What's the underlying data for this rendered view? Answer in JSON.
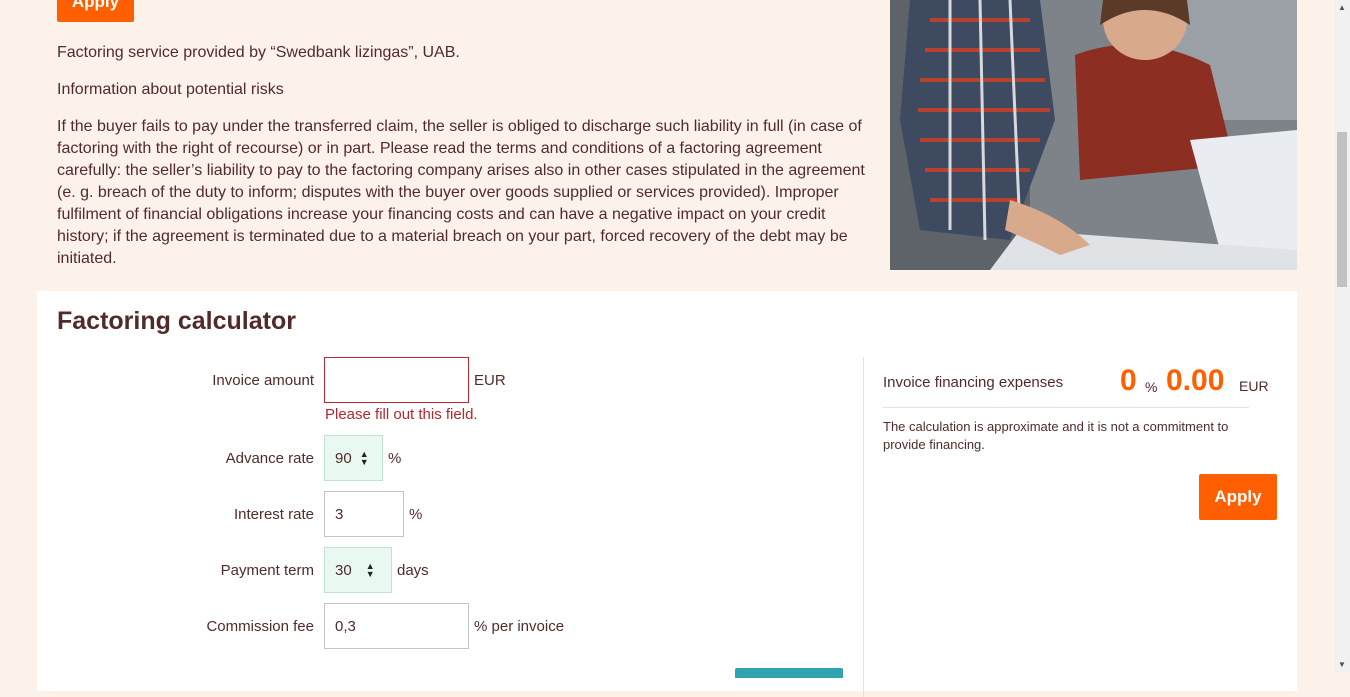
{
  "top": {
    "apply_label": "Apply"
  },
  "info": {
    "provider": "Factoring service provided by “Swedbank lizingas”, UAB.",
    "risks_title": "Information about potential risks",
    "risks_text": "If the buyer fails to pay under the transferred claim, the seller is obliged to discharge such liability in full (in case of factoring with the right of recourse) or in part. Please read the terms and conditions of a factoring agreement carefully: the seller’s liability to pay to the factoring company arises also in other cases stipulated in the agreement (e. g. breach of the duty to inform; disputes with the buyer over goods supplied or services provided). Improper fulfilment of financial obligations increase your financing costs and can have a negative impact on your credit history; if the agreement is terminated due to a material breach on your part, forced recovery of the debt may be initiated."
  },
  "calculator": {
    "title": "Factoring calculator",
    "invoice_amount": {
      "label": "Invoice amount",
      "value": "",
      "unit": "EUR",
      "error": "Please fill out this field."
    },
    "advance_rate": {
      "label": "Advance rate",
      "value": "90",
      "unit": "%"
    },
    "interest_rate": {
      "label": "Interest rate",
      "value": "3",
      "unit": "%"
    },
    "payment_term": {
      "label": "Payment term",
      "value": "30",
      "unit": "days"
    },
    "commission_fee": {
      "label": "Commission fee",
      "value": "0,3",
      "unit": "% per invoice"
    }
  },
  "result": {
    "label": "Invoice financing expenses",
    "percent": "0",
    "percent_unit": "%",
    "amount": "0.00",
    "amount_unit": "EUR",
    "note": "The calculation is approximate and it is not a commitment to provide financing.",
    "apply_label": "Apply"
  },
  "colors": {
    "accent": "#ff5f00",
    "text": "#512b2b",
    "error": "#b4272d",
    "background": "#fdf2ea"
  }
}
